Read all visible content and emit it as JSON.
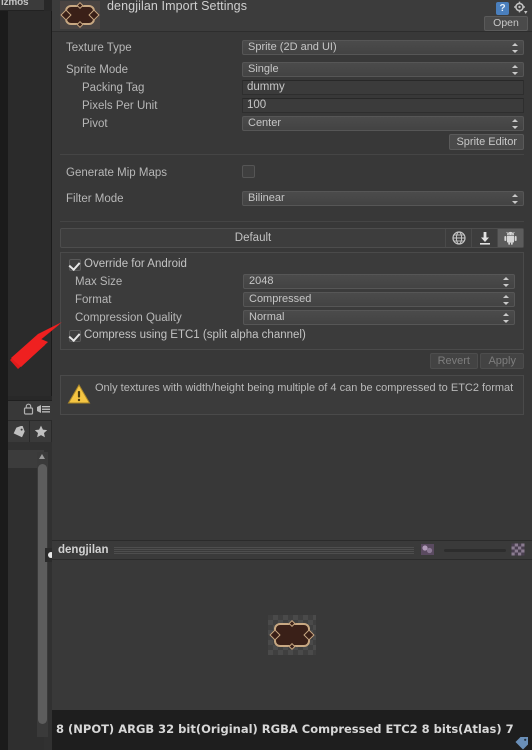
{
  "window": {
    "gizmos_fragment": "izmos",
    "asset_title": "dengjilan Import Settings",
    "open_button": "Open",
    "help_icon": "?",
    "icons": {
      "help": "help-icon",
      "gear": "gear-icon",
      "lock": "lock-icon",
      "menu": "menu-icon",
      "tag": "tag-icon",
      "star": "star-icon"
    }
  },
  "settings": {
    "texture_type": {
      "label": "Texture Type",
      "value": "Sprite (2D and UI)"
    },
    "sprite_mode": {
      "label": "Sprite Mode",
      "value": "Single"
    },
    "packing_tag": {
      "label": "Packing Tag",
      "value": "dummy"
    },
    "pixels_per_unit": {
      "label": "Pixels Per Unit",
      "value": "100"
    },
    "pivot": {
      "label": "Pivot",
      "value": "Center"
    },
    "sprite_editor_button": "Sprite Editor",
    "generate_mip_maps": {
      "label": "Generate Mip Maps",
      "checked": false
    },
    "filter_mode": {
      "label": "Filter Mode",
      "value": "Bilinear"
    }
  },
  "platform_bar": {
    "default_label": "Default",
    "tabs": [
      {
        "name": "web-platform",
        "icon": "globe-icon",
        "selected": false
      },
      {
        "name": "standalone-platform",
        "icon": "download-icon",
        "selected": false
      },
      {
        "name": "android-platform",
        "icon": "android-icon",
        "selected": true
      }
    ]
  },
  "override": {
    "override_for_android": {
      "label": "Override for Android",
      "checked": true
    },
    "max_size": {
      "label": "Max Size",
      "value": "2048"
    },
    "format": {
      "label": "Format",
      "value": "Compressed"
    },
    "compression_quality": {
      "label": "Compression Quality",
      "value": "Normal"
    },
    "compress_etc1": {
      "label": "Compress using ETC1 (split alpha channel)",
      "checked": true
    }
  },
  "actions": {
    "revert": "Revert",
    "apply": "Apply",
    "enabled": false
  },
  "warning": {
    "icon": "warning-triangle-icon",
    "text": "Only textures with width/height being multiple of 4 can be compressed to ETC2 format"
  },
  "preview": {
    "title": "dengjilan",
    "rgb_icon": "rgb-channel-icon",
    "alpha_icon": "checkerboard-icon"
  },
  "status": {
    "text": "8 (NPOT)   ARGB 32 bit(Original) RGBA Compressed ETC2 8 bits(Atlas)   7"
  },
  "colors": {
    "panel": "#383838",
    "header": "#3c3c3c",
    "accent_blue": "#4a7fbd",
    "warning_yellow": "#f0c040",
    "annotation_red": "#e02020",
    "text": "#b7b7b7"
  }
}
